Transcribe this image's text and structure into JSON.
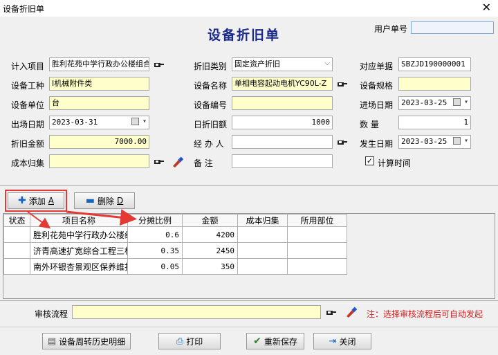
{
  "window": {
    "title": "设备折旧单",
    "close_glyph": "✕"
  },
  "header": {
    "title": "设备折旧单",
    "user_no_label": "用户单号",
    "user_no_value": ""
  },
  "form": {
    "jiru_label": "计入项目",
    "jiru_value": "胜利花苑中学行政办公楼组合办公",
    "category_label": "折旧类别",
    "category_value": "固定资产折旧",
    "ref_label": "对应单据",
    "ref_value": "SBZJD190000001",
    "type_label": "设备工种",
    "type_value": "I机械附件类",
    "name_label": "设备名称",
    "name_value": "单相电容起动电机YC90L-Z",
    "spec_label": "设备规格",
    "spec_value": "",
    "unit_label": "设备单位",
    "unit_value": "台",
    "code_label": "设备编号",
    "code_value": "",
    "in_date_label": "进场日期",
    "in_date_value": "2023-03-25",
    "out_date_label": "出场日期",
    "out_date_value": "2023-03-31",
    "daily_label": "日折旧额",
    "daily_value": "1000",
    "qty_label": "数    量",
    "qty_value": "1",
    "amount_label": "折旧金额",
    "amount_value": "7000.00",
    "handler_label": "经 办 人",
    "handler_value": "",
    "occur_label": "发生日期",
    "occur_value": "2023-03-25",
    "cost_label": "成本归集",
    "cost_value": "",
    "remark_label": "备    注",
    "remark_value": "",
    "calc_time_label": "计算时间",
    "calc_time_checked": true
  },
  "toolbar": {
    "add_label": "添加",
    "add_key": "A",
    "delete_label": "删除",
    "delete_key": "D"
  },
  "table": {
    "columns": [
      "状态",
      "项目名称",
      "分摊比例",
      "金额",
      "成本归集",
      "所用部位"
    ],
    "rows": [
      [
        "",
        "胜利花苑中学行政办公楼组",
        "0.6",
        "4200",
        "",
        ""
      ],
      [
        "",
        "济青高速扩宽综合工程三标",
        "0.35",
        "2450",
        "",
        ""
      ],
      [
        "",
        "南外环银杏景观区保养维护",
        "0.05",
        "350",
        "",
        ""
      ]
    ]
  },
  "approval": {
    "label": "审核流程",
    "value": "",
    "note": "注：选择审核流程后可自动发起"
  },
  "footer": {
    "history_label": "设备周转历史明细",
    "print_label": "打印",
    "resave_label": "重新保存",
    "close_label": "关闭"
  },
  "colors": {
    "title_blue": "#1a2a8c",
    "note_red": "#d81b1b",
    "highlight_red": "#e53935",
    "input_yellow": "#ffffcc"
  }
}
